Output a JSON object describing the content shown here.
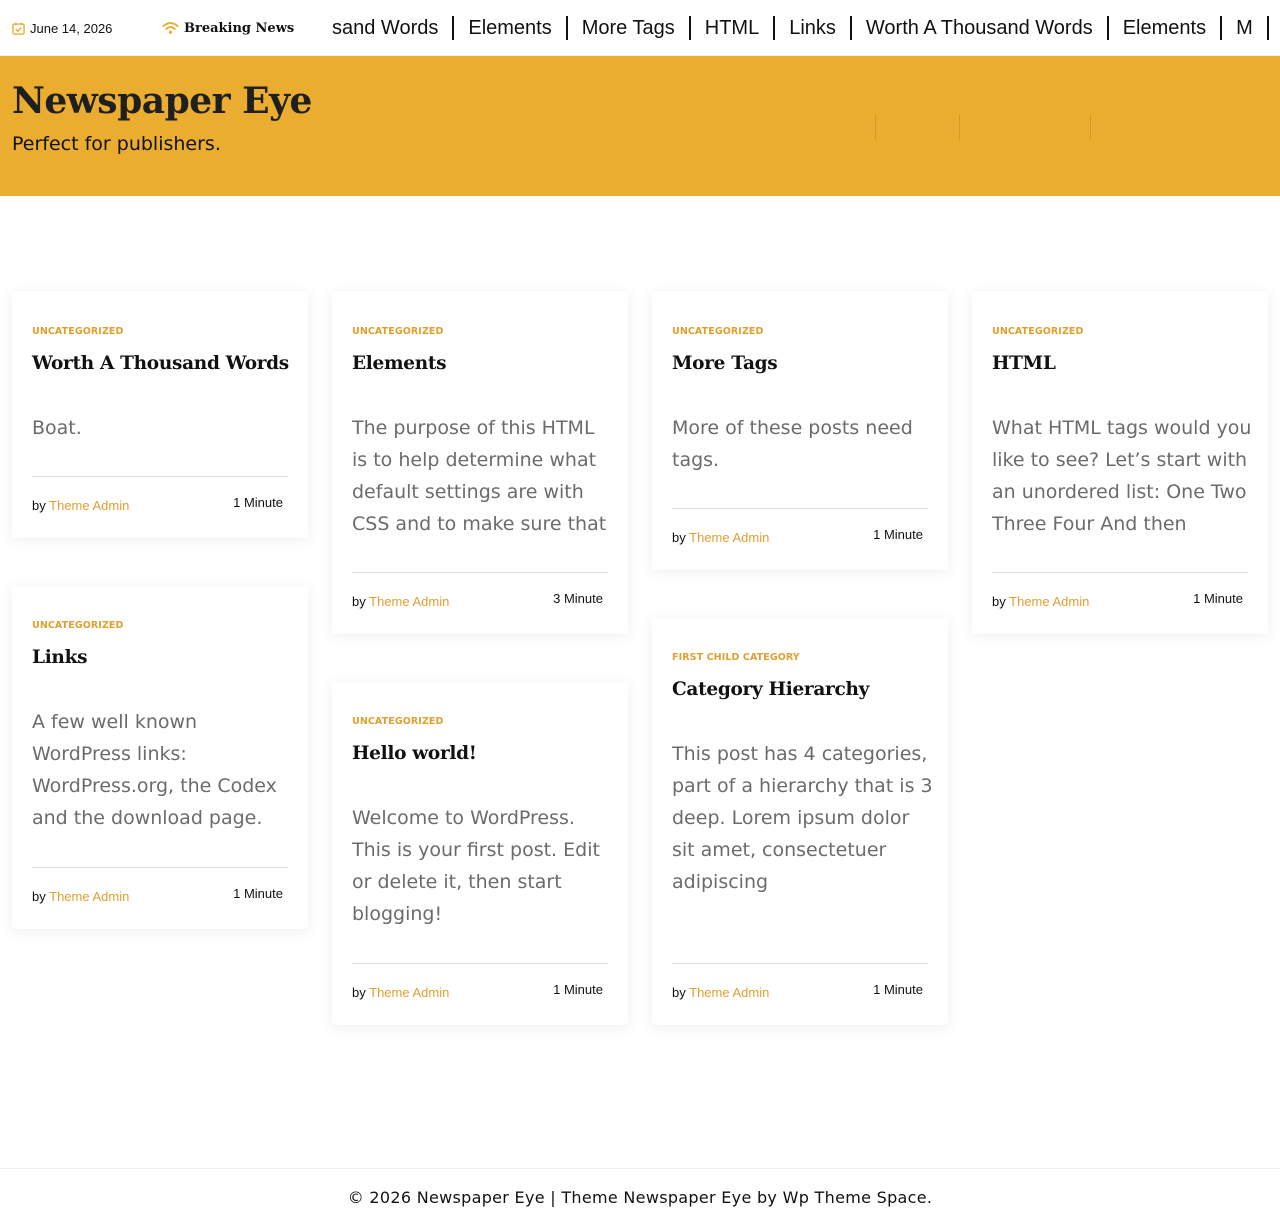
{
  "topbar": {
    "date": "June 14, 2026",
    "calendar_icon": "calendar-check-icon",
    "breaking_icon": "wifi-signal-icon",
    "breaking_label": "Breaking News",
    "ticker": [
      "sand Words",
      "Elements",
      "More Tags",
      "HTML",
      "Links",
      "Worth A Thousand Words",
      "Elements",
      "M"
    ]
  },
  "header": {
    "title": "Newspaper Eye",
    "tagline": "Perfect for publishers.",
    "background_color": "#eaad2f"
  },
  "colors": {
    "accent": "#e0a030",
    "excerpt": "#6b6b6b"
  },
  "posts": [
    {
      "category": "UNCATEGORIZED",
      "title": "Worth A Thousand Words",
      "excerpt": "Boat.",
      "by": "by",
      "author": "Theme Admin",
      "read_time": "1 Minute"
    },
    {
      "category": "UNCATEGORIZED",
      "title": "Elements",
      "excerpt": "The purpose of this HTML is to help determine what default settings are with CSS and to make sure that",
      "by": "by",
      "author": "Theme Admin",
      "read_time": "3 Minute"
    },
    {
      "category": "UNCATEGORIZED",
      "title": "More Tags",
      "excerpt": "More of these posts need tags.",
      "by": "by",
      "author": "Theme Admin",
      "read_time": "1 Minute"
    },
    {
      "category": "UNCATEGORIZED",
      "title": "HTML",
      "excerpt": "What HTML tags would you like to see? Let’s start with an unordered list: One Two Three Four And then",
      "by": "by",
      "author": "Theme Admin",
      "read_time": "1 Minute"
    },
    {
      "category": "UNCATEGORIZED",
      "title": "Links",
      "excerpt": "A few well known WordPress links: WordPress.org, the Codex and the download page.",
      "by": "by",
      "author": "Theme Admin",
      "read_time": "1 Minute"
    },
    {
      "category": "UNCATEGORIZED",
      "title": "Hello world!",
      "excerpt": "Welcome to WordPress. This is your first post. Edit or delete it, then start blogging!",
      "by": "by",
      "author": "Theme Admin",
      "read_time": "1 Minute"
    },
    {
      "category": "FIRST CHILD CATEGORY",
      "title": "Category Hierarchy",
      "excerpt": "This post has 4 categories, part of a hierarchy that is 3 deep. Lorem ipsum dolor sit amet, consectetuer adipiscing",
      "by": "by",
      "author": "Theme Admin",
      "read_time": "1 Minute"
    }
  ],
  "footer": {
    "text": "© 2026 Newspaper Eye | Theme Newspaper Eye by Wp Theme Space."
  }
}
